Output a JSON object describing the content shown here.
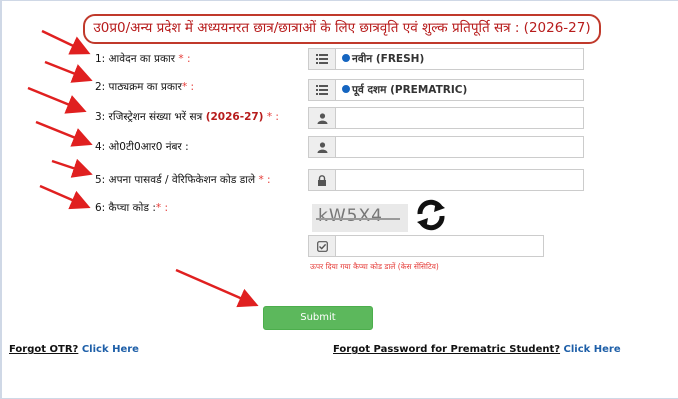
{
  "title": "उ0प्र0/अन्य प्रदेश में अध्ययनरत छात्र/छात्राओं के लिए छात्रवृति एवं शुल्क प्रतिपूर्ति सत्र : (2026-27)",
  "fields": {
    "f1": {
      "label": "1: आवेदन का प्रकार",
      "req": " * :",
      "value": "नवीन (FRESH)",
      "icon": "list-icon"
    },
    "f2": {
      "label": "2: पाठ्यक्रम का प्रकार",
      "req": "* :",
      "value": "पूर्व दशम (PREMATRIC)",
      "icon": "list-icon"
    },
    "f3": {
      "label": "3: रजिस्ट्रेशन संख्या भरें सत्र ",
      "session": "(2026-27)",
      "req": " * :",
      "value": "",
      "icon": "user-icon"
    },
    "f4": {
      "label": "4: ओ0टी0आर0 नंबर :",
      "value": "",
      "icon": "user-icon"
    },
    "f5": {
      "label": "5: अपना पासवर्ड / वेरिफिकेशन कोड डाले",
      "req": " * :",
      "value": "",
      "icon": "lock-icon"
    },
    "f6": {
      "label": "6: कैप्चा कोड :",
      "req": "* :",
      "value": "",
      "icon": "check-icon"
    }
  },
  "captcha": {
    "text": "kW5X4",
    "hint": "ऊपर दिया गया कैप्चा कोड डालें (केस सेंसिटिव)"
  },
  "submit_label": "Submit",
  "links": {
    "otr_q": "Forgot OTR?",
    "otr_a": "Click Here",
    "pw_q": "Forgot Password for Prematric Student?",
    "pw_a": "Click Here"
  },
  "colors": {
    "title": "#b71c1c",
    "required": "#e53935",
    "submit": "#5cb85c",
    "link": "#1e5fa8",
    "arrow": "#e02020"
  }
}
